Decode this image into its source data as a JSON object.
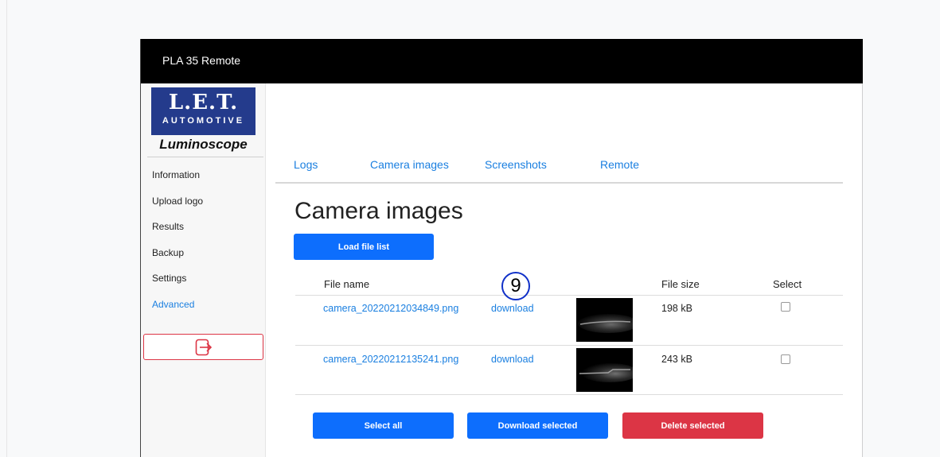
{
  "app": {
    "title": "PLA 35 Remote"
  },
  "logo": {
    "line1": "L.E.T.",
    "line2": "AUTOMOTIVE",
    "line3": "Luminoscope"
  },
  "sidebar": {
    "items": [
      {
        "label": "Information",
        "active": false
      },
      {
        "label": "Upload logo",
        "active": false
      },
      {
        "label": "Results",
        "active": false
      },
      {
        "label": "Backup",
        "active": false
      },
      {
        "label": "Settings",
        "active": false
      },
      {
        "label": "Advanced",
        "active": true
      }
    ],
    "logout_icon": "logout-icon"
  },
  "tabs": [
    {
      "label": "Logs"
    },
    {
      "label": "Camera images"
    },
    {
      "label": "Screenshots"
    },
    {
      "label": "Remote"
    }
  ],
  "page": {
    "title": "Camera images",
    "load_button": "Load file list"
  },
  "table": {
    "headers": {
      "file_name": "File name",
      "file_size": "File size",
      "select": "Select"
    },
    "rows": [
      {
        "file_name": "camera_20220212034849.png",
        "download": "download",
        "size": "198 kB",
        "selected": false
      },
      {
        "file_name": "camera_20220212135241.png",
        "download": "download",
        "size": "243 kB",
        "selected": false
      }
    ]
  },
  "actions": {
    "select_all": "Select all",
    "download_selected": "Download selected",
    "delete_selected": "Delete selected"
  },
  "annotation": {
    "marker": "9"
  },
  "colors": {
    "accent": "#0d6efd",
    "danger": "#dc3545",
    "link": "#1a7fe0",
    "topbar": "#000000",
    "logo_blue": "#243b8c"
  }
}
